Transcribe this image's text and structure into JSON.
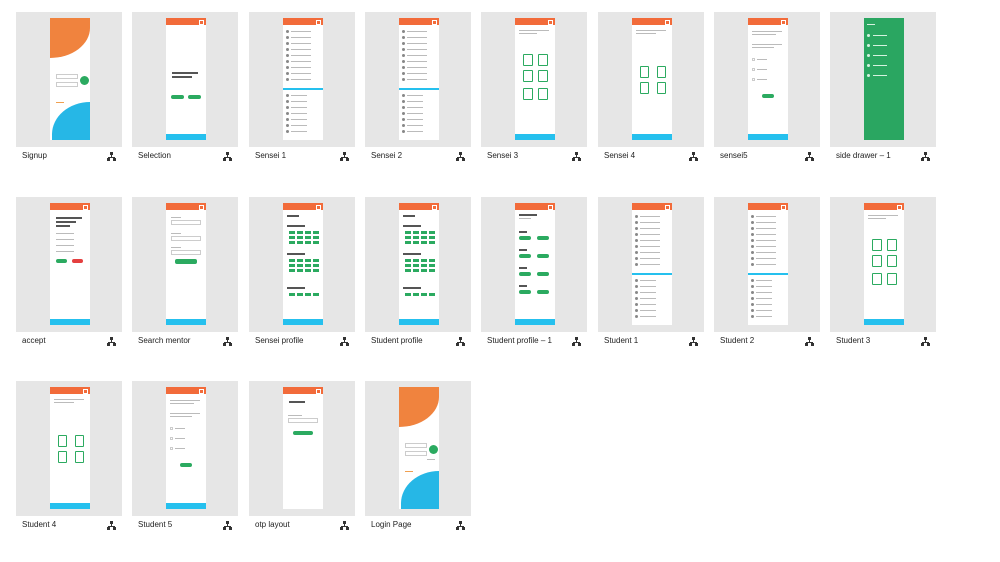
{
  "screens": [
    {
      "label": "Signup"
    },
    {
      "label": "Selection"
    },
    {
      "label": "Sensei 1"
    },
    {
      "label": "Sensei 2"
    },
    {
      "label": "Sensei 3"
    },
    {
      "label": "Sensei 4"
    },
    {
      "label": "sensei5"
    },
    {
      "label": "side drawer – 1"
    },
    {
      "label": "accept"
    },
    {
      "label": "Search mentor"
    },
    {
      "label": "Sensei profile"
    },
    {
      "label": "Student profile"
    },
    {
      "label": "Student profile – 1"
    },
    {
      "label": "Student 1"
    },
    {
      "label": "Student 2"
    },
    {
      "label": "Student 3"
    },
    {
      "label": "Student 4"
    },
    {
      "label": "Student 5"
    },
    {
      "label": "otp layout"
    },
    {
      "label": "Login Page"
    }
  ],
  "colors": {
    "header": "#f26b3a",
    "footer": "#25c0ee",
    "accent_green": "#2baa60",
    "accent_red": "#e43f3f",
    "thumbnail_bg": "#e6e6e6"
  },
  "icons": {
    "share": "share-icon"
  }
}
